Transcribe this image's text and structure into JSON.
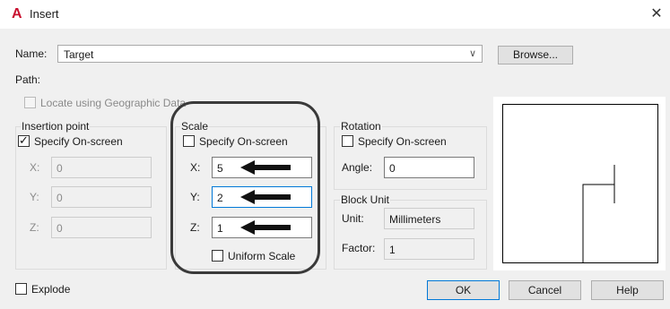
{
  "titlebar": {
    "icon": "autocad-a-icon",
    "title": "Insert",
    "close_glyph": "✕"
  },
  "name_row": {
    "label": "Name:",
    "value": "Target",
    "browse_label": "Browse..."
  },
  "path": {
    "label": "Path:"
  },
  "geo": {
    "label": "Locate using Geographic Data",
    "checked": false
  },
  "insertion_point": {
    "title": "Insertion point",
    "specify_label": "Specify On-screen",
    "specify_checked": true,
    "x_label": "X:",
    "x_value": "0",
    "y_label": "Y:",
    "y_value": "0",
    "z_label": "Z:",
    "z_value": "0"
  },
  "scale": {
    "title": "Scale",
    "specify_label": "Specify On-screen",
    "specify_checked": false,
    "x_label": "X:",
    "x_value": "5",
    "y_label": "Y:",
    "y_value": "2",
    "z_label": "Z:",
    "z_value": "1",
    "uniform_label": "Uniform Scale",
    "uniform_checked": false
  },
  "rotation": {
    "title": "Rotation",
    "specify_label": "Specify On-screen",
    "specify_checked": false,
    "angle_label": "Angle:",
    "angle_value": "0"
  },
  "block_unit": {
    "title": "Block Unit",
    "unit_label": "Unit:",
    "unit_value": "Millimeters",
    "factor_label": "Factor:",
    "factor_value": "1"
  },
  "explode": {
    "label": "Explode",
    "checked": false
  },
  "buttons": {
    "ok": "OK",
    "cancel": "Cancel",
    "help": "Help"
  },
  "colors": {
    "accent": "#0078d7",
    "brand": "#c8102e",
    "annotation": "#3a3a3a"
  }
}
